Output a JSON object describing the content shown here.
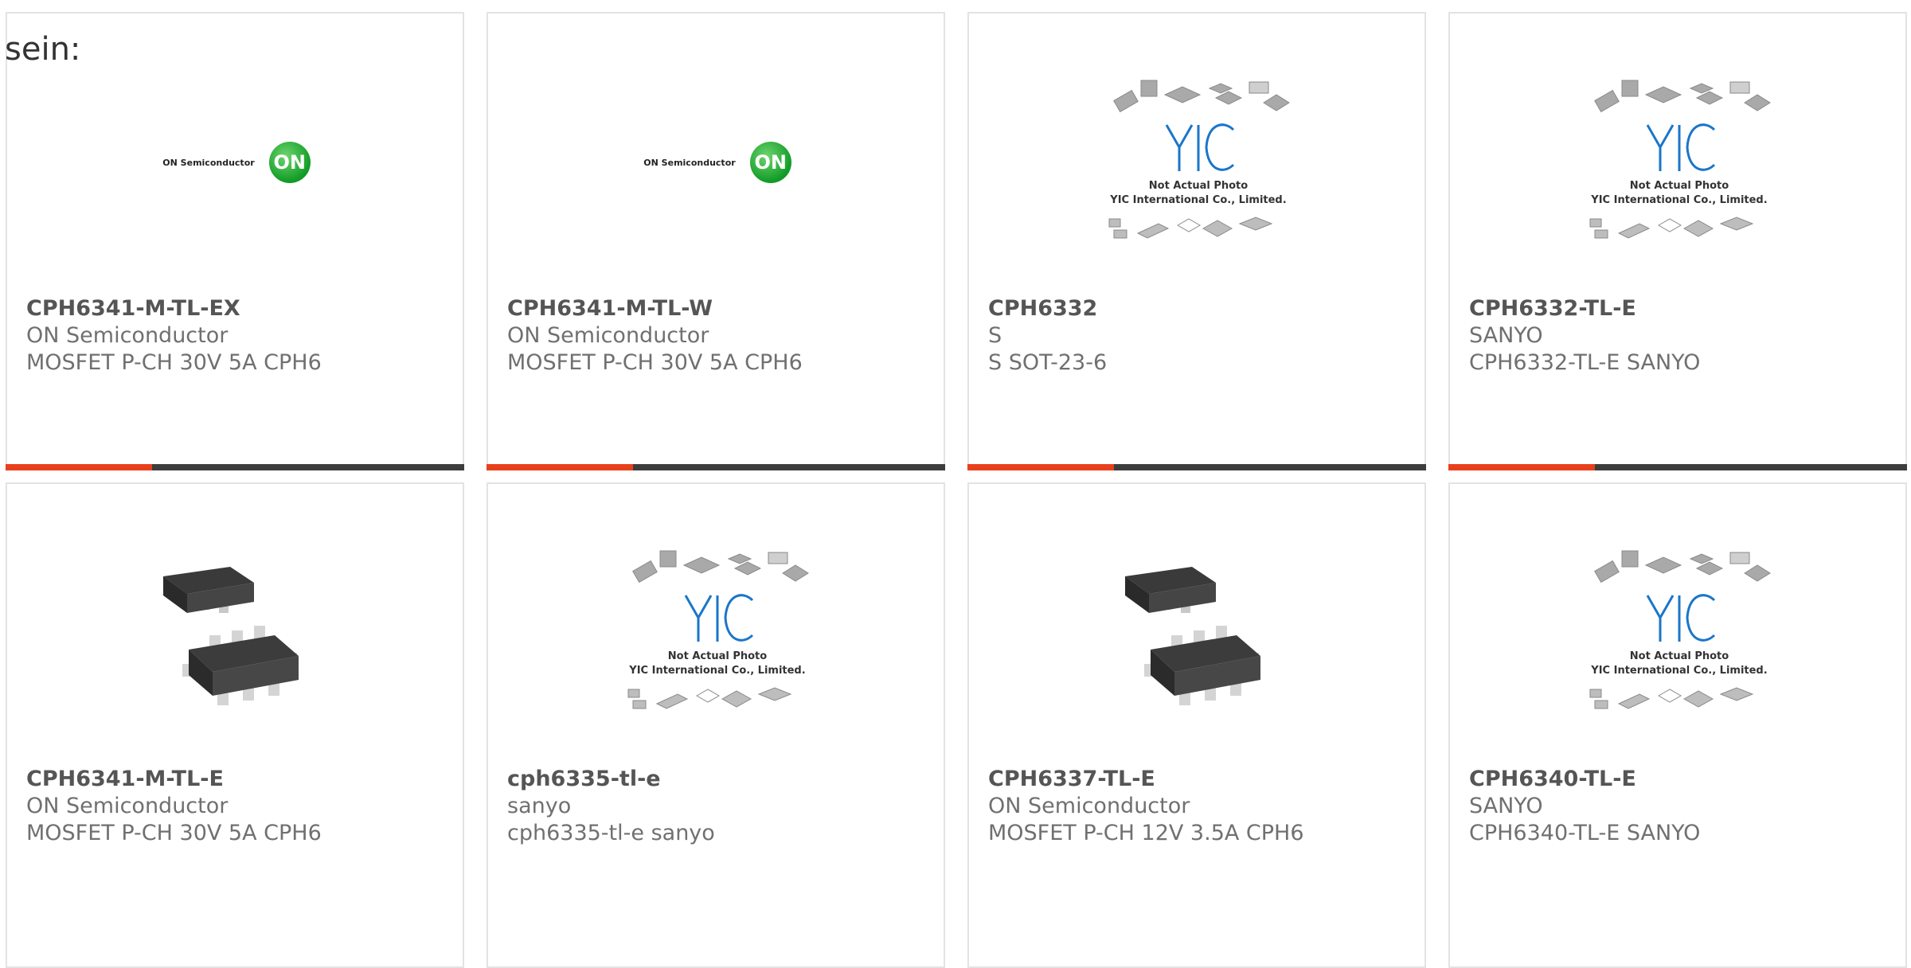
{
  "intro": "sein:",
  "products": [
    {
      "part": "CPH6341-M-TL-EX",
      "maker": "ON Semiconductor",
      "desc": "MOSFET P-CH 30V 5A CPH6",
      "image": "on-semiconductor-logo",
      "logo_text": "ON Semiconductor",
      "logo_badge": "ON"
    },
    {
      "part": "CPH6341-M-TL-W",
      "maker": "ON Semiconductor",
      "desc": "MOSFET P-CH 30V 5A CPH6",
      "image": "on-semiconductor-logo",
      "logo_text": "ON Semiconductor",
      "logo_badge": "ON"
    },
    {
      "part": "CPH6332",
      "maker": "S",
      "desc": "S SOT-23-6",
      "image": "yic-placeholder",
      "photo_line1": "Not Actual Photo",
      "photo_line2": "YIC International Co., Limited."
    },
    {
      "part": "CPH6332-TL-E",
      "maker": "SANYO",
      "desc": "CPH6332-TL-E SANYO",
      "image": "yic-placeholder",
      "photo_line1": "Not Actual Photo",
      "photo_line2": "YIC International Co., Limited."
    },
    {
      "part": "CPH6341-M-TL-E",
      "maker": "ON Semiconductor",
      "desc": "MOSFET P-CH 30V 5A CPH6",
      "image": "sot-chip-photo"
    },
    {
      "part": "cph6335-tl-e",
      "maker": "sanyo",
      "desc": "cph6335-tl-e sanyo",
      "image": "yic-placeholder",
      "photo_line1": "Not Actual Photo",
      "photo_line2": "YIC International Co., Limited."
    },
    {
      "part": "CPH6337-TL-E",
      "maker": "ON Semiconductor",
      "desc": "MOSFET P-CH 12V 3.5A CPH6",
      "image": "sot-chip-photo"
    },
    {
      "part": "CPH6340-TL-E",
      "maker": "SANYO",
      "desc": "CPH6340-TL-E SANYO",
      "image": "yic-placeholder",
      "photo_line1": "Not Actual Photo",
      "photo_line2": "YIC International Co., Limited."
    }
  ],
  "colors": {
    "accent": "#e8401c",
    "bar": "#3d3d3d",
    "border": "#e3e3e3",
    "yic_blue": "#1a76c9"
  }
}
